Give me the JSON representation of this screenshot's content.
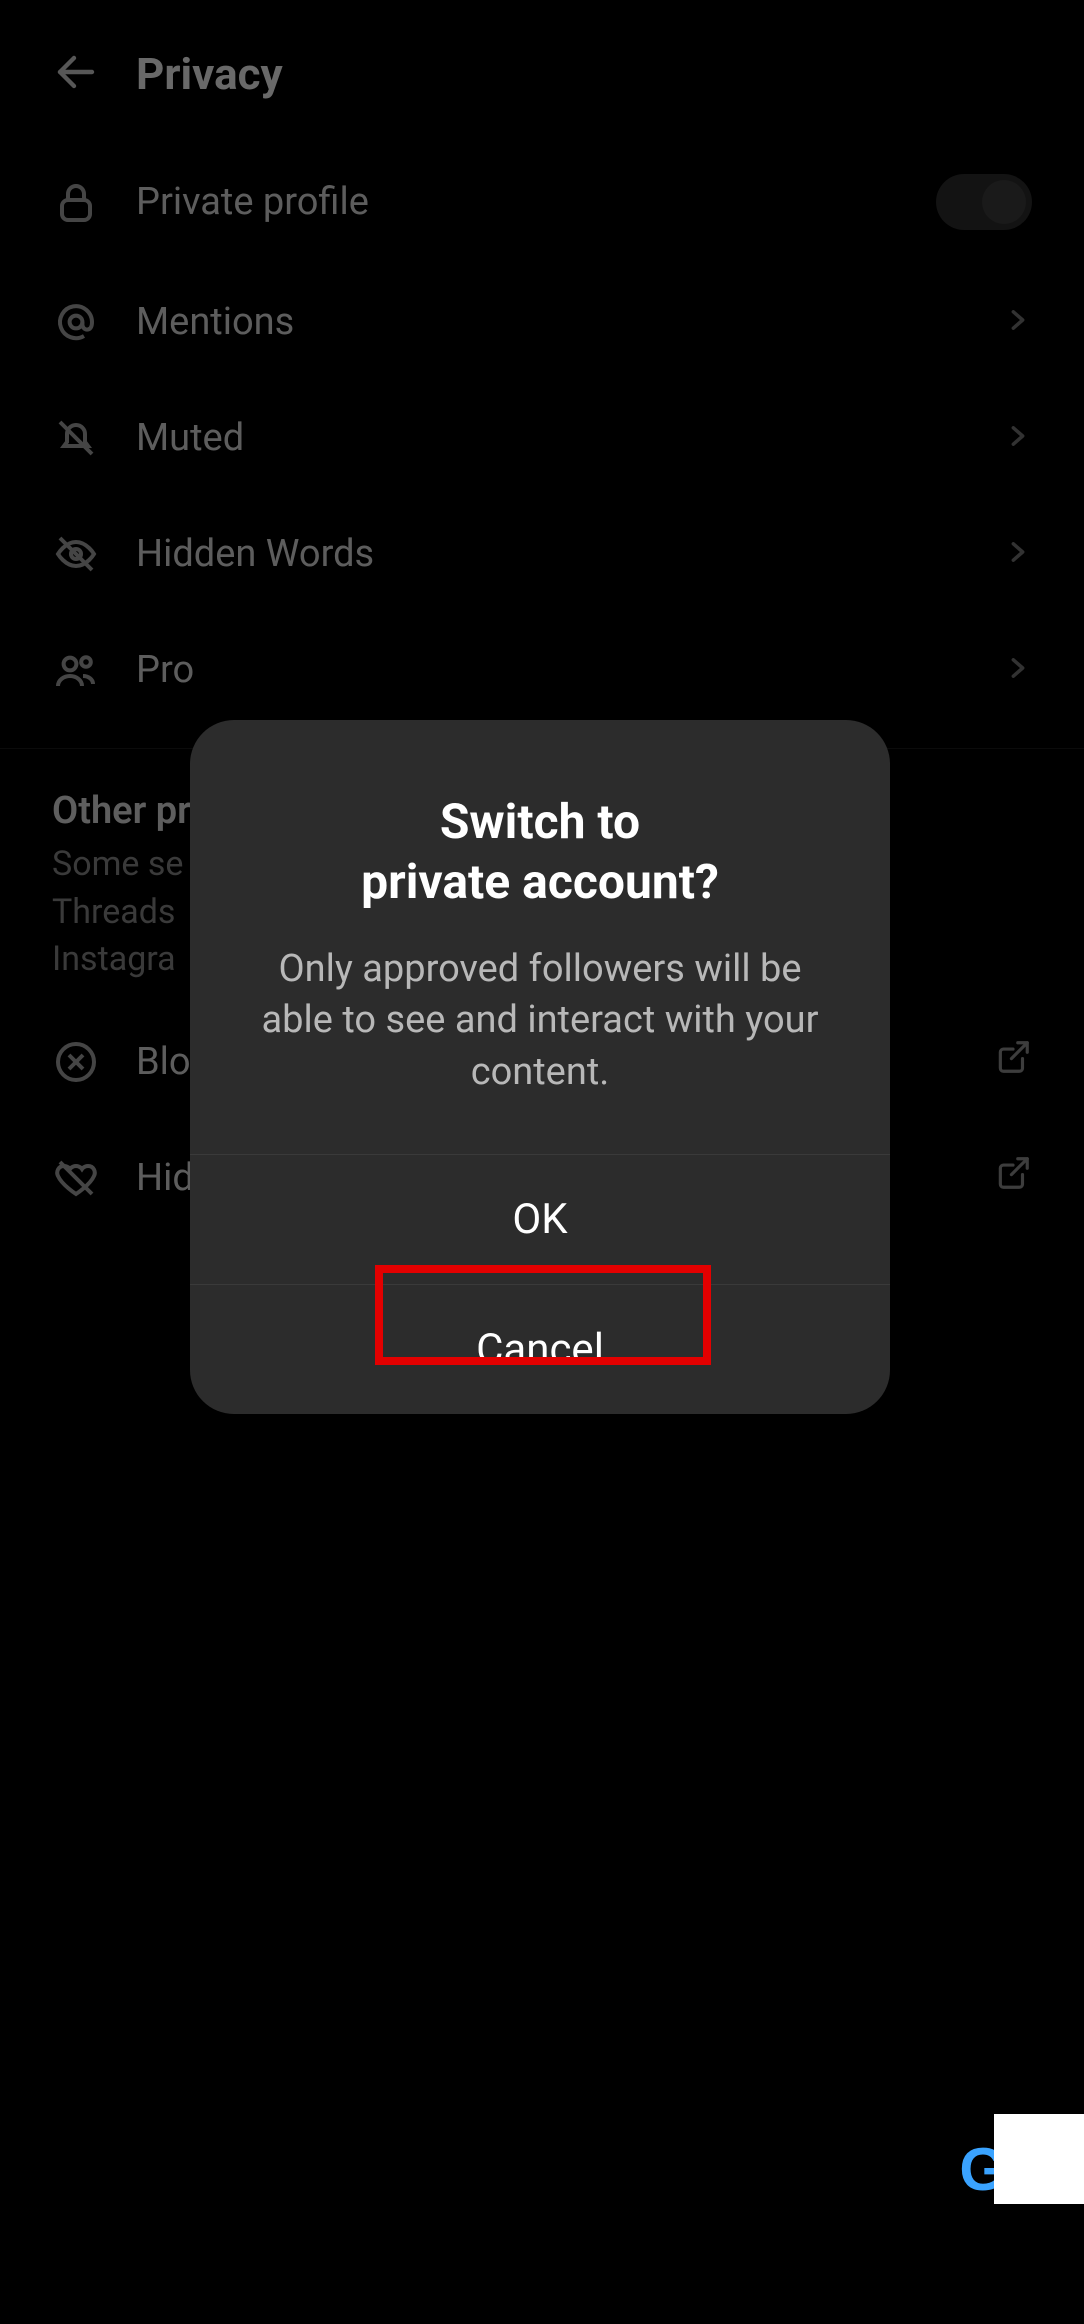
{
  "header": {
    "title": "Privacy"
  },
  "rows": {
    "private_profile": "Private profile",
    "mentions": "Mentions",
    "muted": "Muted",
    "hidden_words": "Hidden Words",
    "profiles": "Pro",
    "blocked": "Blo",
    "hidden_likes": "Hid"
  },
  "section": {
    "heading": "Other pr",
    "sub_line1": "Some se",
    "sub_line2": "Threads",
    "sub_line3": "Instagra"
  },
  "modal": {
    "title": "Switch to\nprivate account?",
    "body": "Only approved followers will be able to see and interact with your content.",
    "ok": "OK",
    "cancel": "Cancel"
  },
  "watermark": {
    "text": "G"
  }
}
